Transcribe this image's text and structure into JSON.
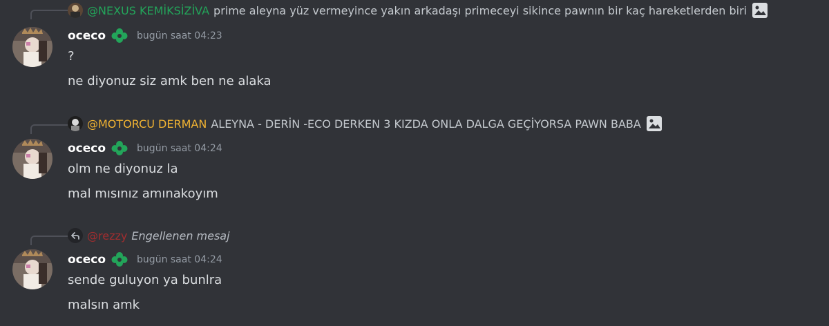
{
  "groups": [
    {
      "reply": {
        "username": "@NEXUS KEMİKSİZİVA",
        "username_color": "#23a55a",
        "text": "prime aleyna yüz vermeyince yakın arkadaşı primeceyi sikince pawnın bir kaç hareketlerden biri",
        "attachment_icon": "image-icon"
      },
      "author": "oceco",
      "timestamp": "bugün saat 04:23",
      "messages": [
        "?",
        "ne diyonuz siz amk ben ne alaka"
      ]
    },
    {
      "reply": {
        "username": "@MOTORCU DERMAN",
        "username_color": "#f0b232",
        "text": "ALEYNA - DERİN -ECO  DERKEN 3 KIZDA ONLA DALGA GEÇİYORSA PAWN BABA",
        "attachment_icon": "image-icon"
      },
      "author": "oceco",
      "timestamp": "bugün saat 04:24",
      "messages": [
        "olm ne diyonuz la",
        "mal mısınız amınakoyım"
      ]
    },
    {
      "reply": {
        "username": "@rezzy",
        "username_color": "#a12d2f",
        "text": "Engellenen mesaj",
        "icon": "reply-arrow-icon"
      },
      "author": "oceco",
      "timestamp": "bugün saat 04:24",
      "messages": [
        "sende guluyon ya bunlra",
        "malsın amk"
      ]
    }
  ],
  "colors": {
    "background": "#313338",
    "badge": "#23a55a"
  }
}
